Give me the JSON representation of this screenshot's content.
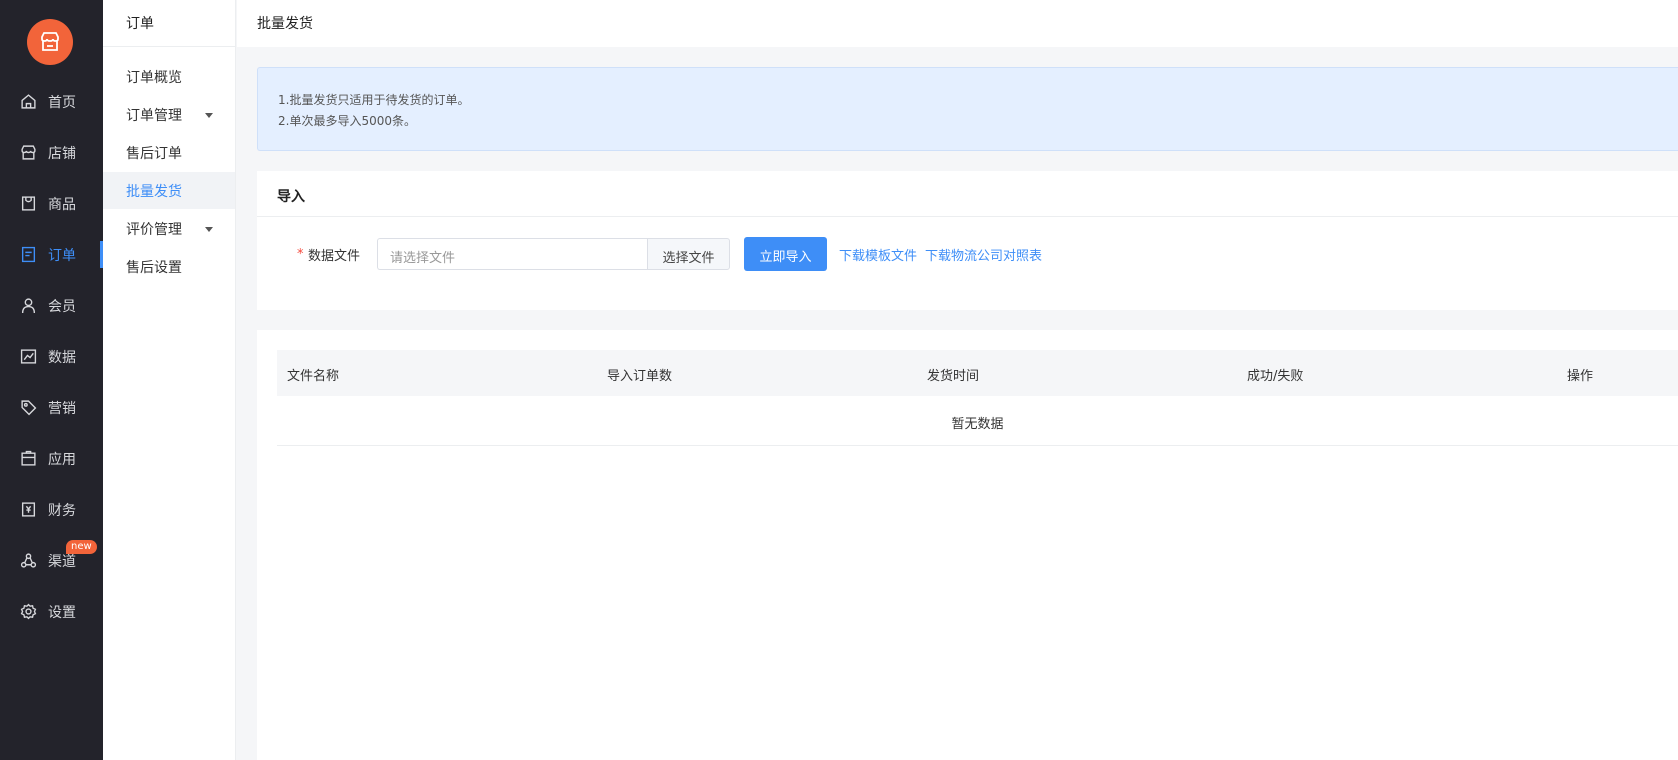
{
  "nav": {
    "items": [
      {
        "label": "首页",
        "icon": "home-icon"
      },
      {
        "label": "店铺",
        "icon": "store-icon"
      },
      {
        "label": "商品",
        "icon": "goods-icon"
      },
      {
        "label": "订单",
        "icon": "order-icon",
        "active": true
      },
      {
        "label": "会员",
        "icon": "user-icon"
      },
      {
        "label": "数据",
        "icon": "chart-icon"
      },
      {
        "label": "营销",
        "icon": "tag-icon"
      },
      {
        "label": "应用",
        "icon": "app-icon"
      },
      {
        "label": "财务",
        "icon": "finance-icon"
      },
      {
        "label": "渠道",
        "icon": "channel-icon",
        "badge": "new"
      },
      {
        "label": "设置",
        "icon": "gear-icon"
      }
    ],
    "accent": "#3e8ef7",
    "logo_color": "#f2643a"
  },
  "subnav": {
    "title": "订单",
    "items": [
      {
        "label": "订单概览"
      },
      {
        "label": "订单管理",
        "expandable": true
      },
      {
        "label": "售后订单"
      },
      {
        "label": "批量发货",
        "active": true
      },
      {
        "label": "评价管理",
        "expandable": true
      },
      {
        "label": "售后设置"
      }
    ]
  },
  "header": {
    "title": "批量发货"
  },
  "notice": {
    "lines": [
      "1.批量发货只适用于待发货的订单。",
      "2.单次最多导入5000条。"
    ]
  },
  "import": {
    "title": "导入",
    "required_mark": "*",
    "field_label": "数据文件",
    "file_placeholder": "请选择文件",
    "choose_button": "选择文件",
    "import_button": "立即导入",
    "download_template": "下载模板文件",
    "download_logistics": "下载物流公司对照表"
  },
  "table": {
    "columns": [
      "文件名称",
      "导入订单数",
      "发货时间",
      "成功/失败",
      "操作"
    ],
    "empty_text": "暂无数据"
  }
}
